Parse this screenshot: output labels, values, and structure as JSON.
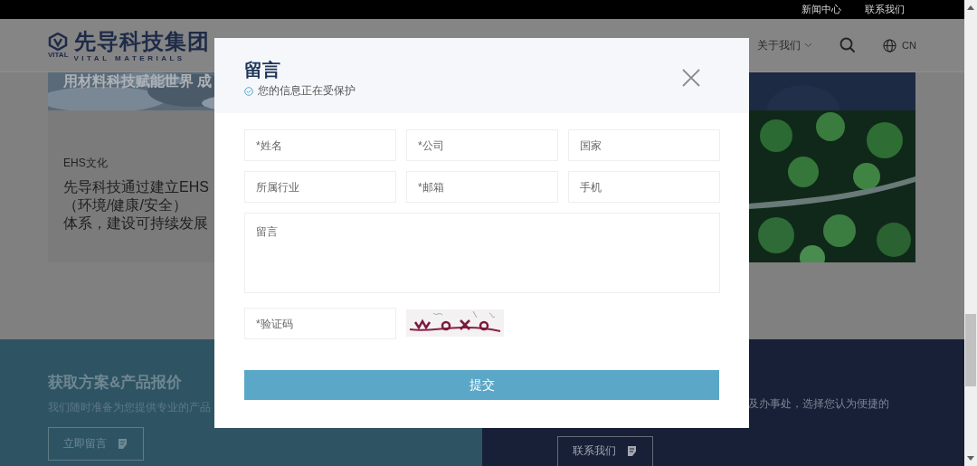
{
  "top_bar": {
    "links": [
      "新闻中心",
      "联系我们"
    ]
  },
  "header": {
    "logo": {
      "name": "先导科技集团",
      "badge": "VITAL",
      "tagline": "VITAL MATERIALS"
    },
    "menu": "关于我们",
    "language": "CN"
  },
  "banner": {
    "text": "用材料科技赋能世界 成"
  },
  "card": {
    "tag": "EHS文化",
    "lines": [
      "先导科技通过建立EHS",
      "（环境/健康/安全）",
      "体系，建设可持续发展"
    ]
  },
  "cta": {
    "left": {
      "title": "获取方案&产品报价",
      "text": "我们随时准备为您提供专业的产品",
      "button": "立即留言"
    },
    "right": {
      "text": "及办事处，选择您认为便捷的",
      "button": "联系我们"
    }
  },
  "dialog": {
    "title": "留言",
    "subtitle": "您的信息正在受保护",
    "fields": [
      {
        "kind": "input",
        "placeholder": "*姓名"
      },
      {
        "kind": "input",
        "placeholder": "*公司"
      },
      {
        "kind": "input",
        "placeholder": "国家"
      },
      {
        "kind": "input",
        "placeholder": "所属行业"
      },
      {
        "kind": "input",
        "placeholder": "*邮箱"
      },
      {
        "kind": "input",
        "placeholder": "手机"
      },
      {
        "kind": "textarea",
        "placeholder": "留言"
      },
      {
        "kind": "captcha",
        "placeholder": "*验证码"
      }
    ],
    "submit": "提交"
  }
}
